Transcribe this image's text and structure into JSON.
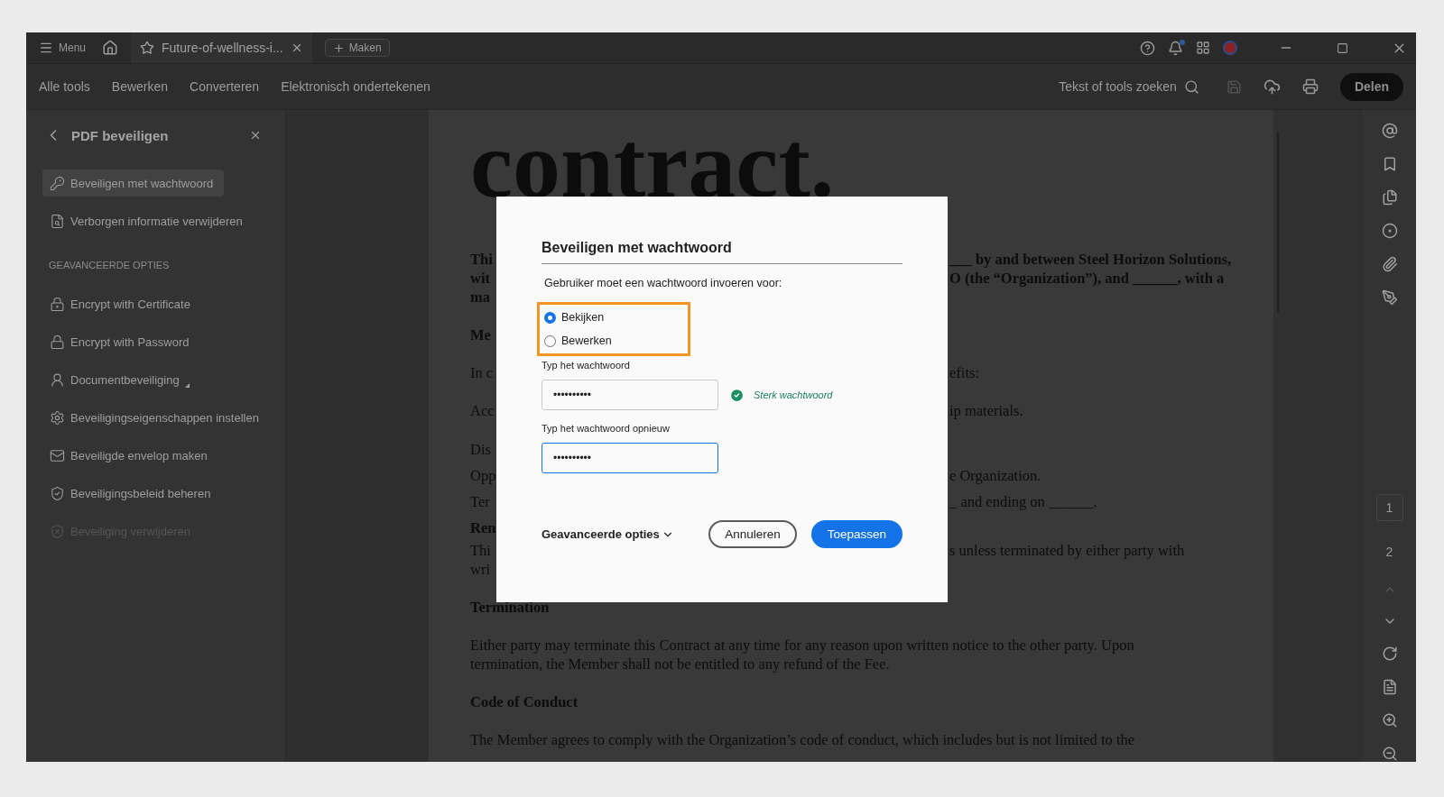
{
  "app": {
    "menu_label": "Menu",
    "tabs": [
      {
        "title": "Future-of-wellness-i..."
      }
    ],
    "new_button": "Maken",
    "notification_dot": true
  },
  "toolbar": {
    "items": [
      "Alle tools",
      "Bewerken",
      "Converteren",
      "Elektronisch ondertekenen"
    ],
    "search_label": "Tekst of tools zoeken",
    "save_disabled": true,
    "share_button": "Delen"
  },
  "sidebar": {
    "title": "PDF beveiligen",
    "items": [
      {
        "label": "Beveiligen met wachtwoord",
        "selected": true,
        "disabled": false,
        "submenu": false
      },
      {
        "label": "Verborgen informatie verwijderen",
        "selected": false,
        "disabled": false,
        "submenu": false
      }
    ],
    "section_title": "GEAVANCEERDE OPTIES",
    "advanced_items": [
      {
        "label": "Encrypt with Certificate",
        "selected": false,
        "disabled": false,
        "submenu": false
      },
      {
        "label": "Encrypt with Password",
        "selected": false,
        "disabled": false,
        "submenu": false
      },
      {
        "label": "Documentbeveiliging",
        "selected": false,
        "disabled": false,
        "submenu": true
      },
      {
        "label": "Beveiligingseigenschappen instellen",
        "selected": false,
        "disabled": false,
        "submenu": false
      },
      {
        "label": "Beveiligde envelop maken",
        "selected": false,
        "disabled": false,
        "submenu": false
      },
      {
        "label": "Beveiligingsbeleid beheren",
        "selected": false,
        "disabled": false,
        "submenu": false
      },
      {
        "label": "Beveiliging verwijderen",
        "selected": false,
        "disabled": true,
        "submenu": false
      }
    ]
  },
  "document": {
    "title": "contract.",
    "blocks": [
      {
        "kind": "paragraph",
        "bold": true,
        "lines": [
          {
            "left": "Thi",
            "right": "___ by and between Steel Horizon Solutions,"
          },
          {
            "left": "wit",
            "right": "O (the “Organization”), and ______, with a"
          },
          {
            "left": "ma"
          }
        ]
      },
      {
        "kind": "paragraph",
        "bold": true,
        "lines": [
          {
            "left": "Me"
          }
        ]
      },
      {
        "kind": "paragraph",
        "bold": false,
        "lines": [
          {
            "left": "In c",
            "right": "efits:"
          }
        ]
      },
      {
        "kind": "paragraph",
        "bold": false,
        "lines": [
          {
            "left": "Acc",
            "right": "ip materials."
          }
        ]
      },
      {
        "kind": "item",
        "bold": false,
        "lines": [
          {
            "left": "Dis"
          }
        ]
      },
      {
        "kind": "item",
        "bold": false,
        "lines": [
          {
            "left": "Opp",
            "right": "e Organization."
          }
        ]
      },
      {
        "kind": "item",
        "bold": false,
        "lines": [
          {
            "left": "Ter",
            "right": "_ and ending on ______."
          }
        ]
      },
      {
        "kind": "item",
        "bold": true,
        "lines": [
          {
            "left": "Ren"
          }
        ]
      },
      {
        "kind": "paragraph",
        "bold": false,
        "lines": [
          {
            "left": "Thi",
            "right": "s unless terminated by either party with"
          },
          {
            "left": "wri"
          }
        ]
      },
      {
        "kind": "paragraph",
        "bold": true,
        "lines": [
          {
            "left": "Termination"
          }
        ]
      },
      {
        "kind": "paragraph",
        "bold": false,
        "lines": [
          {
            "left": "Either party may terminate this Contract at any time for any reason upon written notice to the other party. Upon"
          },
          {
            "left": "termination, the Member shall not be entitled to any refund of the Fee."
          }
        ]
      },
      {
        "kind": "paragraph",
        "bold": true,
        "lines": [
          {
            "left": "Code of Conduct"
          }
        ]
      },
      {
        "kind": "paragraph",
        "bold": false,
        "lines": [
          {
            "left": "The Member agrees to comply with the Organization’s code of conduct, which includes but is not limited to the"
          }
        ]
      }
    ]
  },
  "dialog": {
    "title": "Beveiligen met wachtwoord",
    "prompt": "Gebruiker moet een wachtwoord invoeren voor:",
    "radio_group_highlighted": true,
    "options": [
      {
        "label": "Bekijken",
        "selected": true
      },
      {
        "label": "Bewerken",
        "selected": false
      }
    ],
    "fields": [
      {
        "label": "Typ het wachtwoord",
        "value": "••••••••••",
        "focused": false,
        "strength": "Sterk wachtwoord"
      },
      {
        "label": "Typ het wachtwoord opnieuw",
        "value": "••••••••••",
        "focused": true
      }
    ],
    "advanced_label": "Geavanceerde opties",
    "buttons": [
      {
        "label": "Annuleren",
        "kind": "secondary"
      },
      {
        "label": "Toepassen",
        "kind": "primary"
      }
    ]
  },
  "page_nav": {
    "pages": [
      {
        "label": "1",
        "selected": true
      },
      {
        "label": "2",
        "selected": false
      }
    ],
    "previous_disabled": true
  }
}
